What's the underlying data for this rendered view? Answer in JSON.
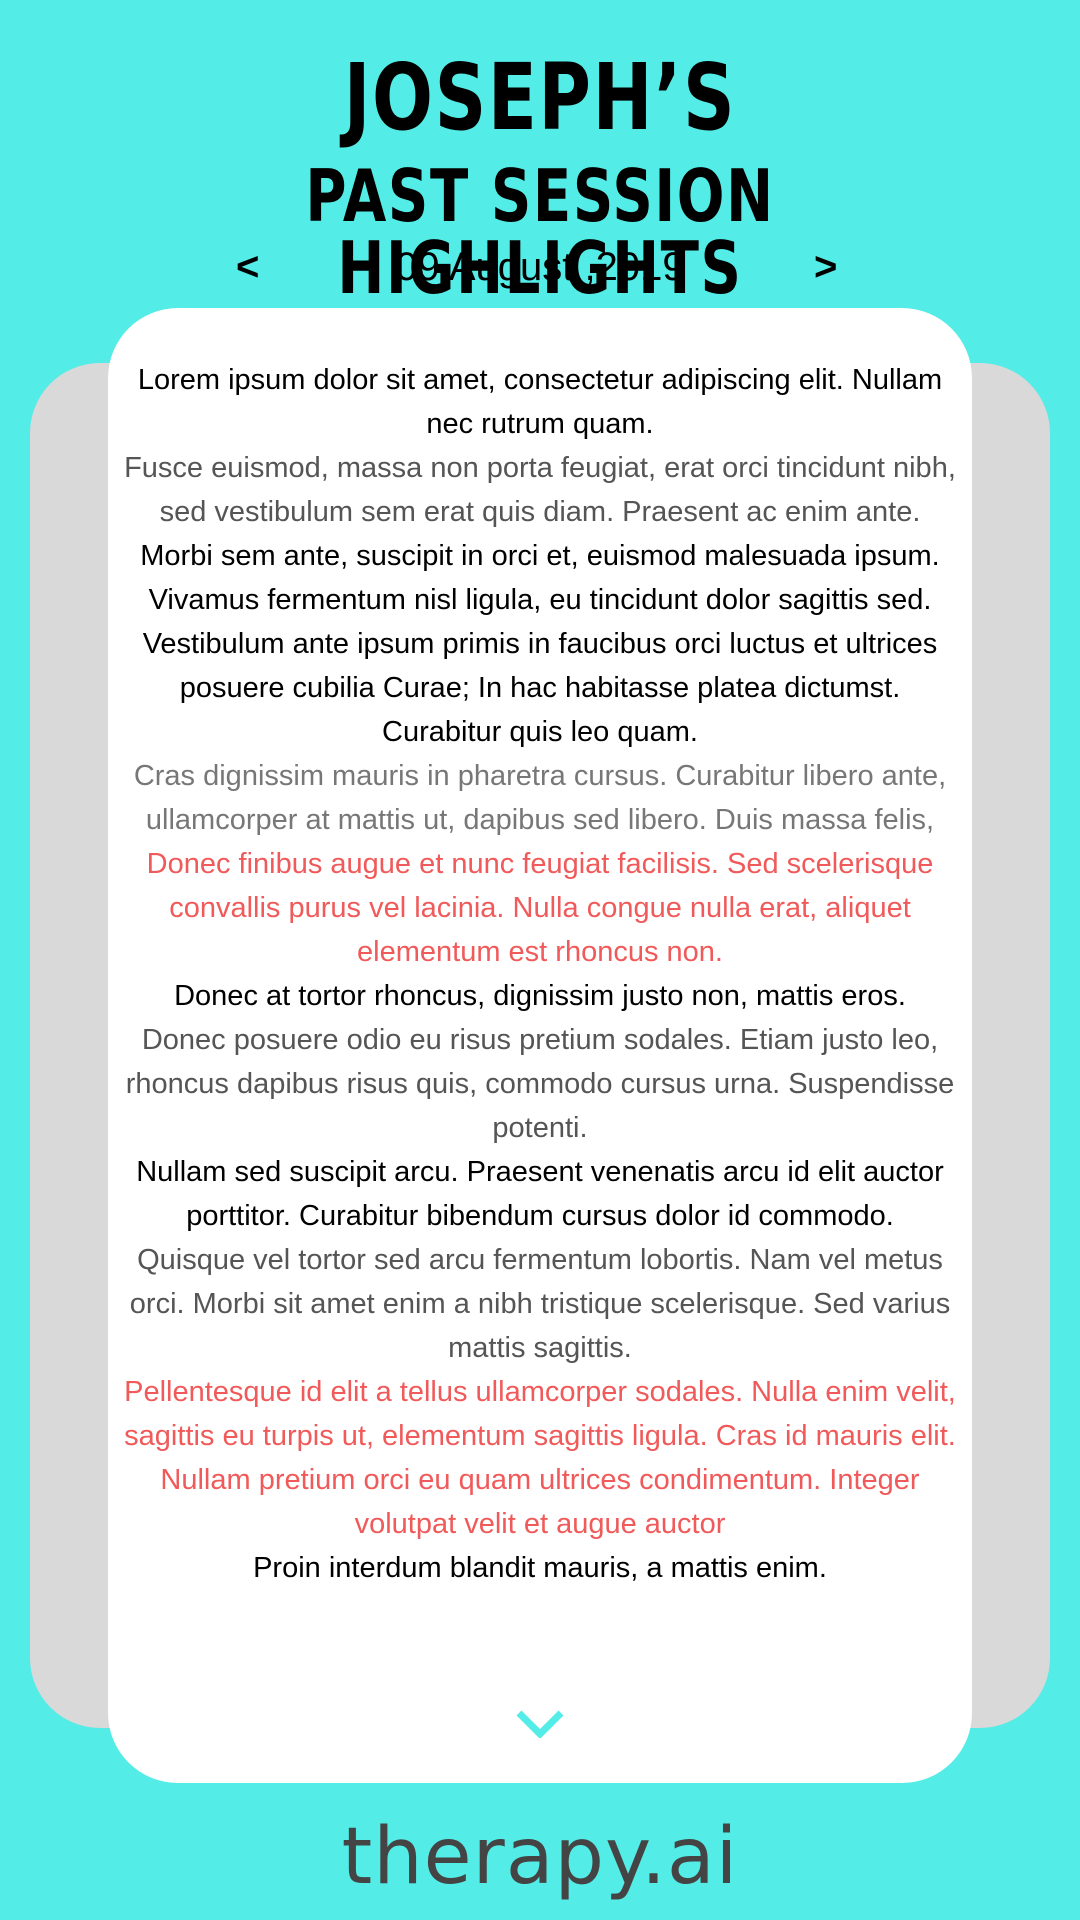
{
  "header": {
    "name": "JOSEPH’S",
    "subtitle": "PAST SESSION HIGHLIGHTS",
    "prev_label": "<",
    "next_label": ">",
    "date": "09 August ,2019"
  },
  "notes": [
    {
      "text": "Lorem ipsum dolor sit amet, consectetur adipiscing elit. Nullam nec rutrum quam.",
      "tone": "black"
    },
    {
      "text": "Fusce euismod, massa non porta feugiat, erat orci tincidunt nibh, sed vestibulum sem erat quis diam. Praesent ac enim ante.",
      "tone": "grey"
    },
    {
      "text": "Morbi sem ante, suscipit in orci et, euismod malesuada ipsum. Vivamus fermentum nisl ligula, eu tincidunt dolor sagittis sed. Vestibulum ante ipsum primis in faucibus orci luctus et ultrices posuere cubilia Curae; In hac habitasse platea dictumst. Curabitur quis leo quam.",
      "tone": "black"
    },
    {
      "text": "Cras dignissim mauris in pharetra cursus. Curabitur libero ante, ullamcorper at mattis ut, dapibus sed libero. Duis massa felis,",
      "tone": "lightgrey"
    },
    {
      "text": "Donec finibus augue et nunc feugiat facilisis. Sed scelerisque convallis purus vel lacinia. Nulla congue nulla erat, aliquet elementum est rhoncus non.",
      "tone": "red"
    },
    {
      "text": "Donec at tortor rhoncus, dignissim justo non, mattis eros.",
      "tone": "black"
    },
    {
      "text": "Donec posuere odio eu risus pretium sodales. Etiam justo leo, rhoncus dapibus risus quis, commodo cursus urna. Suspendisse potenti.",
      "tone": "grey"
    },
    {
      "text": "Nullam sed suscipit arcu. Praesent venenatis arcu id elit auctor porttitor. Curabitur bibendum cursus dolor id commodo.",
      "tone": "black"
    },
    {
      "text": "Quisque vel tortor sed arcu fermentum lobortis. Nam vel metus orci. Morbi sit amet enim a nibh tristique scelerisque. Sed varius mattis sagittis.",
      "tone": "grey"
    },
    {
      "text": "Pellentesque id elit a tellus ullamcorper sodales. Nulla enim velit, sagittis eu turpis ut, elementum sagittis ligula. Cras id mauris elit. Nullam pretium orci eu quam ultrices condimentum. Integer volutpat velit et augue auctor",
      "tone": "red"
    },
    {
      "text": "Proin interdum blandit mauris, a mattis enim.",
      "tone": "black"
    }
  ],
  "footer": {
    "brand": "therapy.ai"
  },
  "colors": {
    "background": "#53ece6",
    "card": "#ffffff",
    "back_card": "#d9d9d9",
    "accent_red": "#f05a5a",
    "chevron": "#53ece6"
  },
  "icons": {
    "scroll": "chevron-down-icon"
  }
}
